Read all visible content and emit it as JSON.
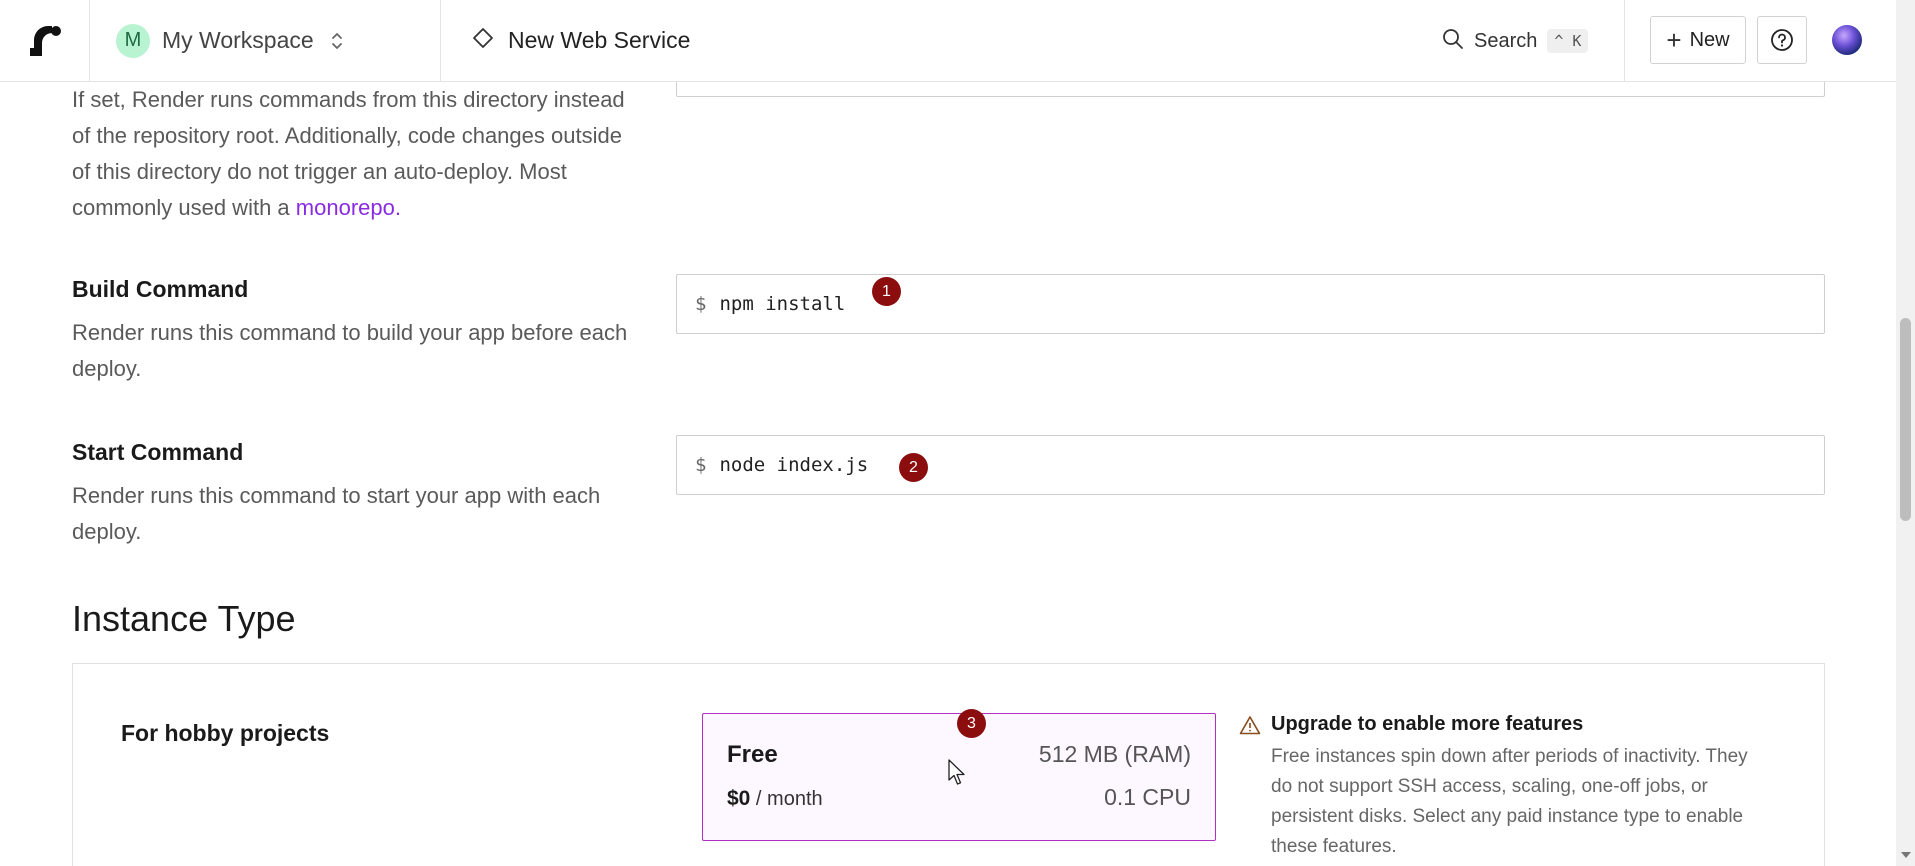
{
  "header": {
    "workspace_initial": "M",
    "workspace_name": "My Workspace",
    "page_title": "New Web Service",
    "search_label": "Search",
    "search_shortcut": "^ K",
    "new_button": "New"
  },
  "form": {
    "root_directory": {
      "description": "If set, Render runs commands from this directory instead of the repository root. Additionally, code changes outside of this directory do not trigger an auto-deploy. Most commonly used with a",
      "link": "monorepo."
    },
    "build_command": {
      "title": "Build Command",
      "description": "Render runs this command to build your app before each deploy.",
      "prompt": "$",
      "value": "npm install",
      "marker": "1"
    },
    "start_command": {
      "title": "Start Command",
      "description": "Render runs this command to start your app with each deploy.",
      "prompt": "$",
      "value": "node index.js",
      "marker": "2"
    }
  },
  "instance_type": {
    "section_title": "Instance Type",
    "group_label": "For hobby projects",
    "plan": {
      "name": "Free",
      "ram": "512 MB (RAM)",
      "price": "$0",
      "period": "/ month",
      "cpu": "0.1 CPU",
      "marker": "3"
    },
    "warning": {
      "title": "Upgrade to enable more features",
      "body": "Free instances spin down after periods of inactivity. They do not support SSH access, scaling, one-off jobs, or persistent disks. Select any paid instance type to enable these features."
    }
  },
  "colors": {
    "accent": "#8a2be2",
    "selected_border": "#b12fc2",
    "marker": "#8b0d0d",
    "workspace_avatar": "#b9f4d2"
  },
  "icons": [
    "render-logo-icon",
    "chevrons-updown-icon",
    "diamond-icon",
    "search-icon",
    "plus-icon",
    "help-icon",
    "warning-icon",
    "cursor-icon"
  ]
}
